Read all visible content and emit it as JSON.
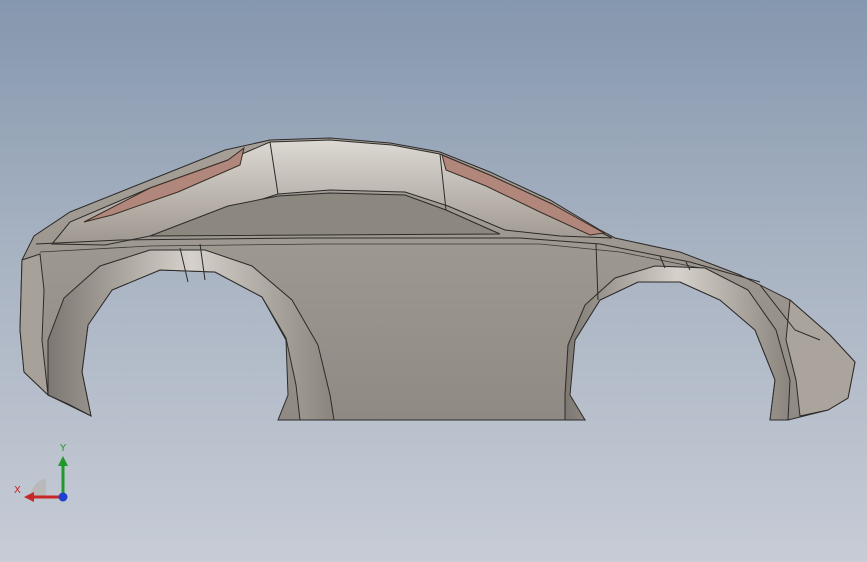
{
  "viewport": {
    "background_top": "#8597ae",
    "background_bottom": "#c7ccd6"
  },
  "model": {
    "view": "side",
    "body_color": "#9a948d",
    "glass_color": "#b0877a"
  },
  "triad": {
    "x_label": "X",
    "y_label": "Y",
    "x_color": "#c62828",
    "y_color": "#1f9a2a",
    "z_color": "#1e3fd0"
  }
}
